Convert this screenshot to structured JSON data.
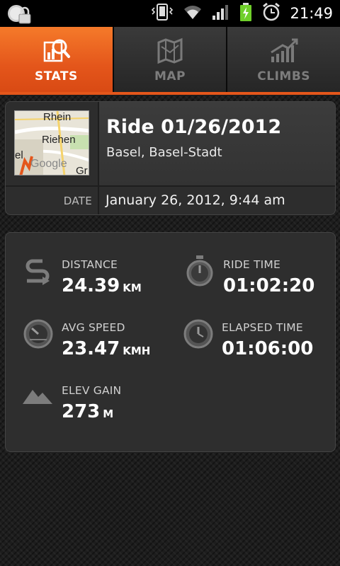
{
  "status_bar": {
    "time": "21:49"
  },
  "tabs": [
    {
      "label": "STATS",
      "icon": "stats-icon",
      "active": true
    },
    {
      "label": "MAP",
      "icon": "map-icon",
      "active": false
    },
    {
      "label": "CLIMBS",
      "icon": "climbs-icon",
      "active": false
    }
  ],
  "ride": {
    "title": "Ride 01/26/2012",
    "location": "Basel, Basel-Stadt",
    "date_label": "DATE",
    "date_value": "January 26, 2012, 9:44 am",
    "map_labels": [
      "Rhein",
      "Riehen",
      "Google",
      "Gr",
      "el"
    ]
  },
  "stats": {
    "distance": {
      "label": "DISTANCE",
      "value": "24.39",
      "unit": "KM",
      "icon": "distance-icon"
    },
    "ride_time": {
      "label": "RIDE TIME",
      "value": "01:02:20",
      "icon": "stopwatch-icon"
    },
    "avg_speed": {
      "label": "AVG SPEED",
      "value": "23.47",
      "unit": "KMH",
      "icon": "speedometer-icon"
    },
    "elapsed_time": {
      "label": "ELAPSED TIME",
      "value": "01:06:00",
      "icon": "clock-icon"
    },
    "elev_gain": {
      "label": "ELEV GAIN",
      "value": "273",
      "unit": "M",
      "icon": "mountain-icon"
    }
  },
  "colors": {
    "accent": "#e4561b",
    "card_bg": "#2e2e2e",
    "text": "#ffffff"
  }
}
